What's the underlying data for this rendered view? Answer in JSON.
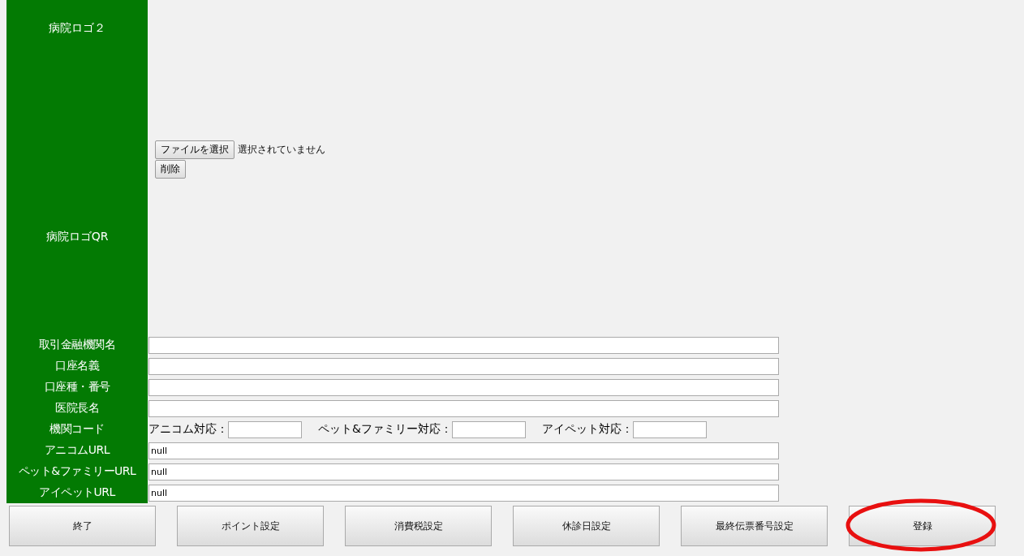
{
  "logo_rows": [
    {
      "label": "病院ロゴ２"
    },
    {
      "label": "病院ロゴQR",
      "file_button": "ファイルを選択",
      "file_status": "選択されていません",
      "delete_button": "削除"
    }
  ],
  "fields": [
    {
      "label": "取引金融機関名",
      "kind": "text"
    },
    {
      "label": "口座名義",
      "kind": "text"
    },
    {
      "label": "口座種・番号",
      "kind": "text"
    },
    {
      "label": "医院長名",
      "kind": "text"
    },
    {
      "label": "機関コード",
      "kind": "codes",
      "codes": [
        {
          "label": "アニコム対応："
        },
        {
          "label": "ペット&ファミリー対応："
        },
        {
          "label": "アイペット対応："
        }
      ]
    },
    {
      "label": "アニコムURL",
      "kind": "text",
      "value": "null"
    },
    {
      "label": "ペット&ファミリーURL",
      "kind": "text",
      "value": "null"
    },
    {
      "label": "アイペットURL",
      "kind": "text",
      "value": "null"
    }
  ],
  "buttons": [
    {
      "label": "終了",
      "highlighted": false
    },
    {
      "label": "ポイント設定",
      "highlighted": false
    },
    {
      "label": "消費税設定",
      "highlighted": false
    },
    {
      "label": "休診日設定",
      "highlighted": false
    },
    {
      "label": "最終伝票番号設定",
      "highlighted": false
    },
    {
      "label": "登録",
      "highlighted": true
    }
  ]
}
